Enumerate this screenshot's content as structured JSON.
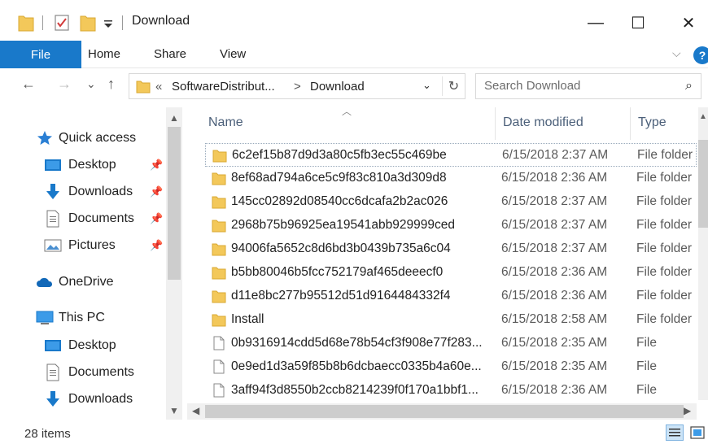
{
  "window": {
    "title": "Download",
    "minimize": "—",
    "maximize": "☐",
    "close": "✕"
  },
  "ribbon": {
    "tabs": [
      "File",
      "Home",
      "Share",
      "View"
    ],
    "collapse": "⌵",
    "help": "?"
  },
  "nav": {
    "back": "←",
    "forward": "→",
    "recent": "⌄",
    "up": "↑"
  },
  "address": {
    "overflow": "«",
    "crumbs": [
      "SoftwareDistribut...",
      "Download"
    ],
    "separator": ">",
    "dropdown": "⌄",
    "refresh": "↻"
  },
  "search": {
    "placeholder": "Search Download",
    "icon": "⌕"
  },
  "sidebar": {
    "items": [
      {
        "label": "Quick access",
        "icon": "star-icon"
      },
      {
        "label": "Desktop",
        "icon": "desktop-icon",
        "pinned": true
      },
      {
        "label": "Downloads",
        "icon": "download-arrow-icon",
        "pinned": true
      },
      {
        "label": "Documents",
        "icon": "document-icon",
        "pinned": true
      },
      {
        "label": "Pictures",
        "icon": "pictures-icon",
        "pinned": true
      },
      {
        "label": "OneDrive",
        "icon": "cloud-icon"
      },
      {
        "label": "This PC",
        "icon": "computer-icon"
      },
      {
        "label": "Desktop",
        "icon": "desktop-icon"
      },
      {
        "label": "Documents",
        "icon": "document-icon"
      },
      {
        "label": "Downloads",
        "icon": "download-arrow-icon"
      }
    ]
  },
  "columns": {
    "name": "Name",
    "date": "Date modified",
    "type": "Type"
  },
  "files": [
    {
      "name": "6c2ef15b87d9d3a80c5fb3ec55c469be",
      "date": "6/15/2018 2:37 AM",
      "type": "File folder",
      "kind": "folder"
    },
    {
      "name": "8ef68ad794a6ce5c9f83c810a3d309d8",
      "date": "6/15/2018 2:36 AM",
      "type": "File folder",
      "kind": "folder"
    },
    {
      "name": "145cc02892d08540cc6dcafa2b2ac026",
      "date": "6/15/2018 2:37 AM",
      "type": "File folder",
      "kind": "folder"
    },
    {
      "name": "2968b75b96925ea19541abb929999ced",
      "date": "6/15/2018 2:37 AM",
      "type": "File folder",
      "kind": "folder"
    },
    {
      "name": "94006fa5652c8d6bd3b0439b735a6c04",
      "date": "6/15/2018 2:37 AM",
      "type": "File folder",
      "kind": "folder"
    },
    {
      "name": "b5bb80046b5fcc752179af465deeecf0",
      "date": "6/15/2018 2:36 AM",
      "type": "File folder",
      "kind": "folder"
    },
    {
      "name": "d11e8bc277b95512d51d9164484332f4",
      "date": "6/15/2018 2:36 AM",
      "type": "File folder",
      "kind": "folder"
    },
    {
      "name": "Install",
      "date": "6/15/2018 2:58 AM",
      "type": "File folder",
      "kind": "folder"
    },
    {
      "name": "0b9316914cdd5d68e78b54cf3f908e77f283...",
      "date": "6/15/2018 2:35 AM",
      "type": "File",
      "kind": "file"
    },
    {
      "name": "0e9ed1d3a59f85b8b6dcbaecc0335b4a60e...",
      "date": "6/15/2018 2:35 AM",
      "type": "File",
      "kind": "file"
    },
    {
      "name": "3aff94f3d8550b2ccb8214239f0f170a1bbf1...",
      "date": "6/15/2018 2:36 AM",
      "type": "File",
      "kind": "file"
    }
  ],
  "status": {
    "count": "28 items"
  },
  "colors": {
    "accent": "#1979ca",
    "folder": "#f3c85a",
    "header_text": "#4c607a"
  }
}
